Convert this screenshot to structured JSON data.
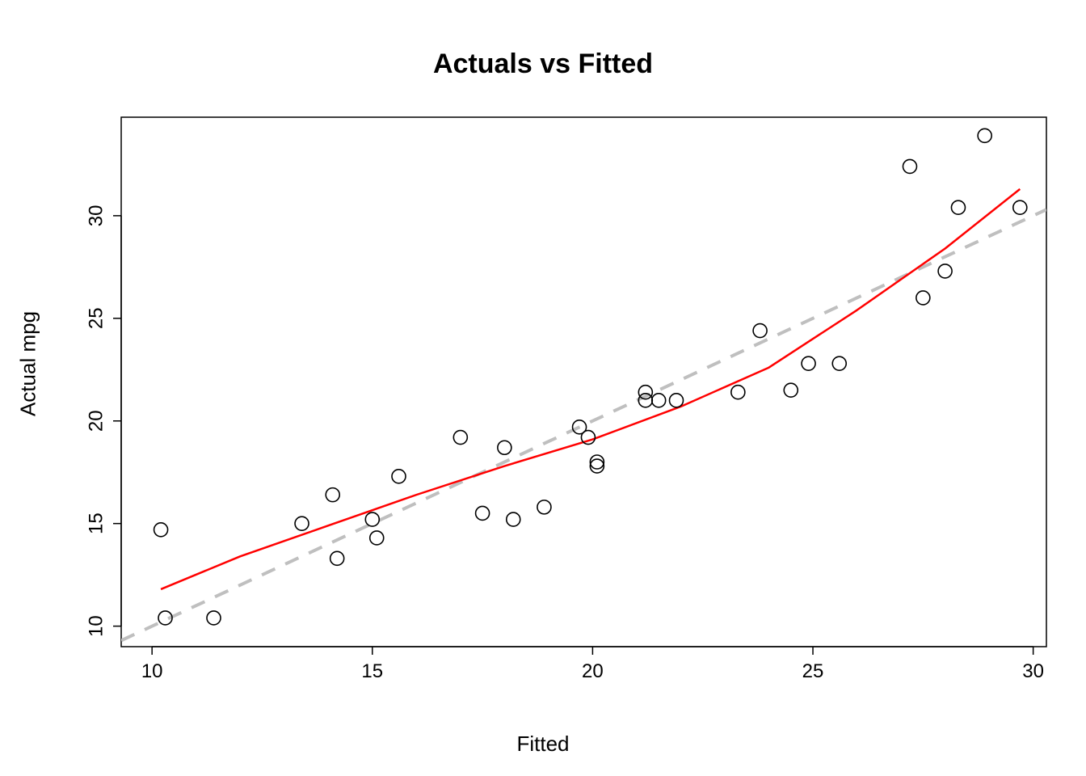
{
  "chart_data": {
    "type": "scatter",
    "title": "Actuals vs Fitted",
    "xlabel": "Fitted",
    "ylabel": "Actual mpg",
    "xlim": [
      9.3,
      30.3
    ],
    "ylim": [
      9.0,
      34.8
    ],
    "x_ticks": [
      10,
      15,
      20,
      25,
      30
    ],
    "y_ticks": [
      10,
      15,
      20,
      25,
      30
    ],
    "points": [
      {
        "x": 10.2,
        "y": 14.7
      },
      {
        "x": 10.3,
        "y": 10.4
      },
      {
        "x": 11.4,
        "y": 10.4
      },
      {
        "x": 13.4,
        "y": 15.0
      },
      {
        "x": 14.1,
        "y": 16.4
      },
      {
        "x": 14.2,
        "y": 13.3
      },
      {
        "x": 15.0,
        "y": 15.2
      },
      {
        "x": 15.1,
        "y": 14.3
      },
      {
        "x": 15.6,
        "y": 17.3
      },
      {
        "x": 17.0,
        "y": 19.2
      },
      {
        "x": 17.5,
        "y": 15.5
      },
      {
        "x": 18.0,
        "y": 18.7
      },
      {
        "x": 18.2,
        "y": 15.2
      },
      {
        "x": 18.9,
        "y": 15.8
      },
      {
        "x": 19.7,
        "y": 19.7
      },
      {
        "x": 19.9,
        "y": 19.2
      },
      {
        "x": 20.1,
        "y": 18.0
      },
      {
        "x": 20.1,
        "y": 17.8
      },
      {
        "x": 21.2,
        "y": 21.0
      },
      {
        "x": 21.2,
        "y": 21.4
      },
      {
        "x": 21.5,
        "y": 21.0
      },
      {
        "x": 21.9,
        "y": 21.0
      },
      {
        "x": 23.3,
        "y": 21.4
      },
      {
        "x": 23.8,
        "y": 24.4
      },
      {
        "x": 24.5,
        "y": 21.5
      },
      {
        "x": 24.9,
        "y": 22.8
      },
      {
        "x": 25.6,
        "y": 22.8
      },
      {
        "x": 27.2,
        "y": 32.4
      },
      {
        "x": 27.5,
        "y": 26.0
      },
      {
        "x": 28.0,
        "y": 27.3
      },
      {
        "x": 28.3,
        "y": 30.4
      },
      {
        "x": 28.9,
        "y": 33.9
      },
      {
        "x": 29.7,
        "y": 30.4
      }
    ],
    "reference_line": {
      "from": {
        "x": 9.3,
        "y": 9.3
      },
      "to": {
        "x": 30.3,
        "y": 30.3
      },
      "style": "dashed",
      "color": "#bfbfbf"
    },
    "smooth_line": {
      "color": "#ff0000",
      "points": [
        {
          "x": 10.2,
          "y": 11.8
        },
        {
          "x": 12.0,
          "y": 13.4
        },
        {
          "x": 14.0,
          "y": 14.9
        },
        {
          "x": 16.0,
          "y": 16.4
        },
        {
          "x": 18.0,
          "y": 17.8
        },
        {
          "x": 20.0,
          "y": 19.1
        },
        {
          "x": 22.0,
          "y": 20.7
        },
        {
          "x": 24.0,
          "y": 22.6
        },
        {
          "x": 26.0,
          "y": 25.4
        },
        {
          "x": 28.0,
          "y": 28.4
        },
        {
          "x": 29.7,
          "y": 31.3
        }
      ]
    }
  }
}
